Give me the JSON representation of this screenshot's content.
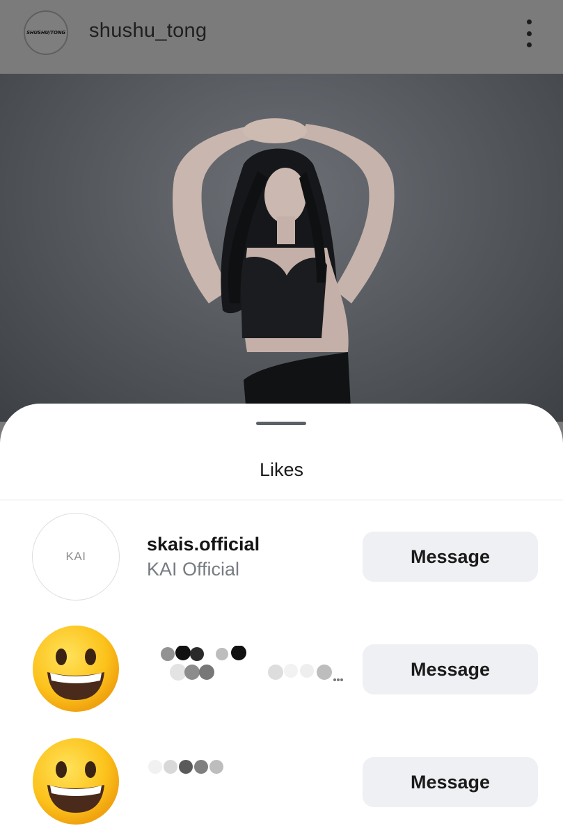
{
  "header": {
    "avatar_text": "SHUSHU/TONG",
    "username": "shushu_tong",
    "more_icon": "kebab-menu-icon"
  },
  "sheet": {
    "title": "Likes",
    "users": [
      {
        "username": "skais.official",
        "display_name": "KAI Official",
        "avatar_text": "KAI",
        "button": "Message"
      },
      {
        "avatar_icon": "smiling-emoji-icon",
        "button": "Message"
      },
      {
        "avatar_icon": "smiling-emoji-icon",
        "button": "Message"
      }
    ]
  }
}
